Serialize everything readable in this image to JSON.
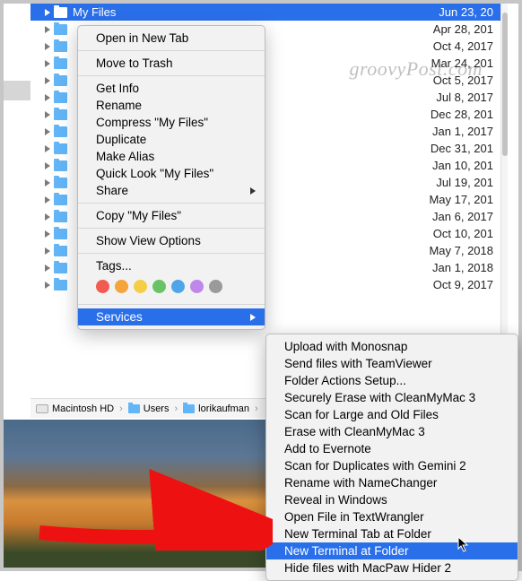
{
  "watermark": "groovyPost.com",
  "selectedFile": {
    "name": "My Files",
    "date": "Jun 23, 20"
  },
  "files": [
    {
      "date": "Apr 28, 201"
    },
    {
      "date": "Oct 4, 2017"
    },
    {
      "date": "Mar 24, 201"
    },
    {
      "date": "Oct 5, 2017"
    },
    {
      "date": "Jul 8, 2017"
    },
    {
      "date": "Dec 28, 201"
    },
    {
      "date": "Jan 1, 2017"
    },
    {
      "date": "Dec 31, 201"
    },
    {
      "date": "Jan 10, 201"
    },
    {
      "date": "Jul 19, 201"
    },
    {
      "date": "May 17, 201"
    },
    {
      "date": "Jan 6, 2017"
    },
    {
      "date": "Oct 10, 201"
    },
    {
      "date": "May 7, 2018"
    },
    {
      "date": "Jan 1, 2018"
    },
    {
      "date": "Oct 9, 2017"
    }
  ],
  "menu": {
    "openNewTab": "Open in New Tab",
    "moveToTrash": "Move to Trash",
    "getInfo": "Get Info",
    "rename": "Rename",
    "compress": "Compress \"My Files\"",
    "duplicate": "Duplicate",
    "makeAlias": "Make Alias",
    "quickLook": "Quick Look \"My Files\"",
    "share": "Share",
    "copy": "Copy \"My Files\"",
    "showViewOptions": "Show View Options",
    "tags": "Tags...",
    "services": "Services"
  },
  "tagColors": [
    "#f25b4f",
    "#f5a43b",
    "#f6cd46",
    "#69c366",
    "#4fa5e7",
    "#bf87e9",
    "#9a9a9a"
  ],
  "services": {
    "uploadMonosnap": "Upload with Monosnap",
    "sendTeamViewer": "Send files with TeamViewer",
    "folderActions": "Folder Actions Setup...",
    "securelyErase": "Securely Erase with CleanMyMac 3",
    "scanLarge": "Scan for Large and Old Files",
    "eraseCMM": "Erase with CleanMyMac 3",
    "addEvernote": "Add to Evernote",
    "scanDuplicates": "Scan for Duplicates with Gemini 2",
    "renameNameChanger": "Rename with NameChanger",
    "revealWindows": "Reveal in Windows",
    "openTextWrangler": "Open File in TextWrangler",
    "newTermTab": "New Terminal Tab at Folder",
    "newTermFolder": "New Terminal at Folder",
    "hideMacPaw": "Hide files with MacPaw Hider 2"
  },
  "path": {
    "disk": "Macintosh HD",
    "users": "Users",
    "user": "lorikaufman"
  }
}
